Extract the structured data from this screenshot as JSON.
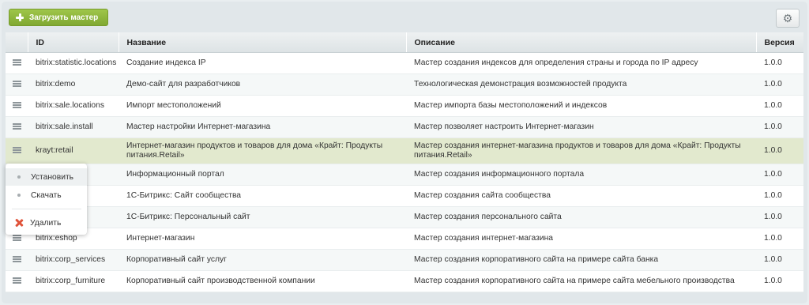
{
  "toolbar": {
    "add_master_label": "Загрузить мастер",
    "add_icon": "plus-icon",
    "settings_icon": "gear-icon"
  },
  "table": {
    "columns": [
      "",
      "ID",
      "Название",
      "Описание",
      "Версия"
    ],
    "rows": [
      {
        "id": "bitrix:statistic.locations",
        "name": "Создание индекса IP",
        "description": "Мастер создания индексов для определения страны и города по IP адресу",
        "version": "1.0.0"
      },
      {
        "id": "bitrix:demo",
        "name": "Демо-сайт для разработчиков",
        "description": "Технологическая демонстрация возможностей продукта",
        "version": "1.0.0"
      },
      {
        "id": "bitrix:sale.locations",
        "name": "Импорт местоположений",
        "description": "Мастер импорта базы местоположений и индексов",
        "version": "1.0.0"
      },
      {
        "id": "bitrix:sale.install",
        "name": "Мастер настройки Интернет-магазина",
        "description": "Мастер позволяет настроить Интернет-магазин",
        "version": "1.0.0"
      },
      {
        "id": "krayt:retail",
        "name": "Интернет-магазин продуктов и товаров для дома «Крайт: Продукты питания.Retail»",
        "description": "Мастер создания интернет-магазина продуктов и товаров для дома «Крайт: Продукты питания.Retail»",
        "version": "1.0.0"
      },
      {
        "id": "al",
        "name": "Информационный портал",
        "description": "Мастер создания информационного портала",
        "version": "1.0.0"
      },
      {
        "id": "ommunity",
        "name": "1С-Битрикс: Сайт сообщества",
        "description": "Мастер создания сайта сообщества",
        "version": "1.0.0"
      },
      {
        "id": "ersonal",
        "name": "1С-Битрикс: Персональный сайт",
        "description": "Мастер создания персонального сайта",
        "version": "1.0.0"
      },
      {
        "id": "bitrix:eshop",
        "name": "Интернет-магазин",
        "description": "Мастер создания интернет-магазина",
        "version": "1.0.0"
      },
      {
        "id": "bitrix:corp_services",
        "name": "Корпоративный сайт услуг",
        "description": "Мастер создания корпоративного сайта на примере сайта банка",
        "version": "1.0.0"
      },
      {
        "id": "bitrix:corp_furniture",
        "name": "Корпоративный сайт производственной компании",
        "description": "Мастер создания корпоративного сайта на примере сайта мебельного производства",
        "version": "1.0.0"
      }
    ],
    "selected_row": 4,
    "colors": {
      "selected_row": "#e2e9ce",
      "add_button": "#8ab43a",
      "delete_icon": "#e0533a"
    }
  },
  "context_menu": {
    "items": [
      {
        "label": "Установить",
        "icon": "bullet-icon",
        "highlighted": true
      },
      {
        "label": "Скачать",
        "icon": "bullet-icon",
        "highlighted": false
      },
      {
        "label": "Удалить",
        "icon": "delete-icon",
        "highlighted": false
      }
    ]
  }
}
